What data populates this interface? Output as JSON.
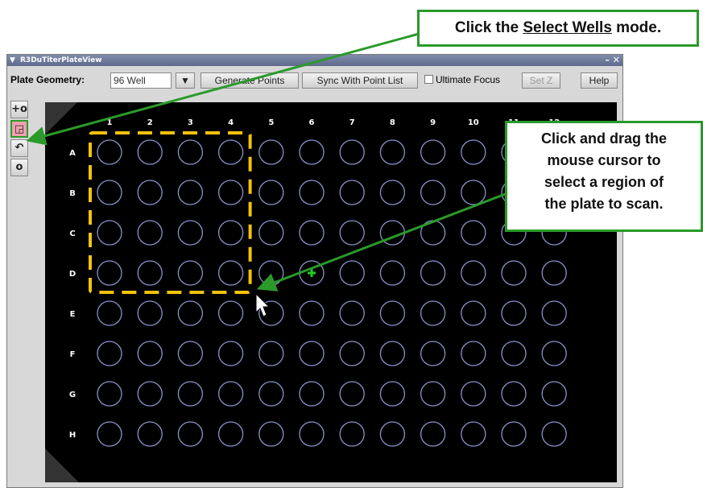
{
  "window": {
    "title": "R3DuTiterPlateView",
    "controls": "– ✕"
  },
  "toolbar": {
    "geometry_label": "Plate Geometry:",
    "geometry_value": "96 Well",
    "generate_label": "Generate Points",
    "sync_label": "Sync With Point List",
    "focus_label": "Ultimate Focus",
    "setz_label": "Set Z",
    "help_label": "Help"
  },
  "tools": {
    "icons": [
      "add-point-icon",
      "select-wells-icon",
      "undo-icon",
      "circle-icon"
    ]
  },
  "plate": {
    "columns": [
      "1",
      "2",
      "3",
      "4",
      "5",
      "6",
      "7",
      "8",
      "9",
      "10",
      "11",
      "12"
    ],
    "rows": [
      "A",
      "B",
      "C",
      "D",
      "E",
      "F",
      "G",
      "H"
    ],
    "marked_well": "D6"
  },
  "callouts": {
    "top_prefix": "Click the ",
    "top_link": "Select Wells",
    "top_suffix": " mode.",
    "side_lines": [
      "Click and drag the",
      "mouse cursor to",
      "select a region of",
      "the plate to scan."
    ]
  },
  "colors": {
    "accent_green": "#2a9a2a",
    "selection_yellow": "#f5c20a",
    "well_outline": "#8a92c8",
    "marker_green": "#22cc22"
  }
}
